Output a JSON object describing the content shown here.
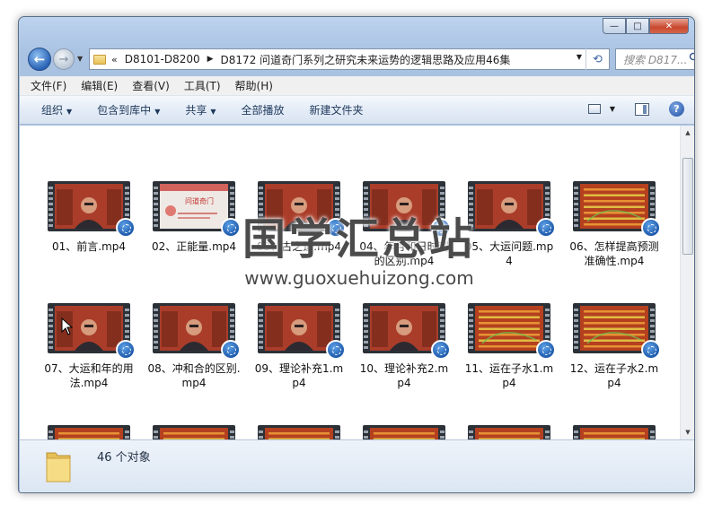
{
  "window": {
    "controls": {
      "minimize": "—",
      "maximize": "□",
      "close": "✕"
    }
  },
  "address": {
    "chevron": "«",
    "crumbs": [
      "D8101-D8200",
      "D8172 问道奇门系列之研究未来运势的逻辑思路及应用46集"
    ],
    "separator": "▶",
    "dropdown": "▼",
    "refresh": "⟲"
  },
  "search": {
    "placeholder": "搜索 D817..."
  },
  "menu": [
    "文件(F)",
    "编辑(E)",
    "查看(V)",
    "工具(T)",
    "帮助(H)"
  ],
  "toolbar": {
    "items": [
      {
        "label": "组织",
        "dropdown": true
      },
      {
        "label": "包含到库中",
        "dropdown": true
      },
      {
        "label": "共享",
        "dropdown": true
      },
      {
        "label": "全部播放",
        "dropdown": false
      },
      {
        "label": "新建文件夹",
        "dropdown": false
      }
    ],
    "help": "?"
  },
  "files": [
    {
      "name": "01、前言.mp4",
      "kind": "person"
    },
    {
      "name": "02、正能量.mp4",
      "kind": "slide",
      "slide_text": "问道奇门"
    },
    {
      "name": "03、古之道.mp4",
      "kind": "person"
    },
    {
      "name": "04、年月和日时刻的区别.mp4",
      "kind": "person"
    },
    {
      "name": "05、大运问题.mp4",
      "kind": "person"
    },
    {
      "name": "06、怎样提高预测准确性.mp4",
      "kind": "chart"
    },
    {
      "name": "07、大运和年的用法.mp4",
      "kind": "person"
    },
    {
      "name": "08、冲和合的区别.mp4",
      "kind": "person"
    },
    {
      "name": "09、理论补充1.mp4",
      "kind": "person"
    },
    {
      "name": "10、理论补充2.mp4",
      "kind": "person"
    },
    {
      "name": "11、运在子水1.mp4",
      "kind": "chart"
    },
    {
      "name": "12、运在子水2.mp4",
      "kind": "chart"
    },
    {
      "name": "",
      "kind": "chart"
    },
    {
      "name": "",
      "kind": "chart"
    },
    {
      "name": "",
      "kind": "chart"
    },
    {
      "name": "",
      "kind": "chart"
    },
    {
      "name": "",
      "kind": "chart"
    },
    {
      "name": "",
      "kind": "chart"
    }
  ],
  "status": {
    "count_text": "46 个对象"
  },
  "watermark": {
    "title": "国学汇总站",
    "url": "www.guoxuehuizong.com"
  }
}
